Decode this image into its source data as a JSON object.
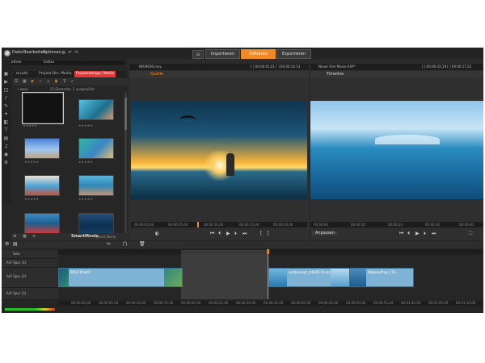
{
  "menu": {
    "items": [
      "Datei",
      "Bearbeiten",
      "Optionen"
    ]
  },
  "main_tabs": [
    {
      "label": "Importieren",
      "active": false
    },
    {
      "label": "Editieren",
      "active": true
    },
    {
      "label": "Exportieren",
      "active": false
    }
  ],
  "library": {
    "tabs": [
      "Bibliothek",
      "Editor",
      "Projekt Bin: Media",
      "Projektablage: Media"
    ],
    "root_tab": "w:(alt)",
    "info": "23 Elemente, 1 ausgewählt",
    "path": "\\ www",
    "smartmovie_label": "SmartMovie",
    "smartmovie_sub": "Smart Movie",
    "stars": "★★★★★"
  },
  "source_panel": {
    "file": "IMG9936.mov",
    "timecode": "[ ] 00:00:01,01 [ ] 00:00:14.13",
    "tab": "Quelle",
    "ruler_labels": [
      "00:00:00,00",
      "00:00:05,00",
      "00:00:10,00",
      "00:00:15,00",
      "00:00:20,00"
    ]
  },
  "timeline_panel": {
    "file": "Neuer Film Movie.AXP*",
    "timecode": "[ ] 00:00:32,19 [ ] 00:00:17,22",
    "tab": "Timeline",
    "fit_label": "Anpassen",
    "ruler_labels": [
      "00:00:00",
      "00:00:10",
      "00:00:20",
      "00:00:30",
      "00:00:40"
    ]
  },
  "timeline": {
    "tracks": [
      {
        "label": "Solo"
      },
      {
        "label": "A/V Spur (1)"
      },
      {
        "label": "A/V Spur (2)"
      },
      {
        "label": "A/V Spur (3)"
      }
    ],
    "clips": [
      {
        "label": "IMG0 Kiteit4"
      },
      {
        "label": "surfpresent_m040174.mov"
      },
      {
        "label": "Wakesurfing_17A..."
      }
    ],
    "ruler_labels": [
      "00:00:00,00",
      "00:00:05,00",
      "00:00:10,00",
      "00:00:15,00",
      "00:00:20,00",
      "00:00:25,00",
      "00:00:30,00",
      "00:00:35,00",
      "00:00:40,00",
      "00:00:45,00",
      "00:00:50,00",
      "00:00:55,00",
      "00:01:00,00",
      "00:01:05,00",
      "00:01:10,00"
    ]
  },
  "colors": {
    "accent": "#f08a24",
    "selected_tab": "#e23a3a",
    "clip": "#7fb3d5"
  }
}
